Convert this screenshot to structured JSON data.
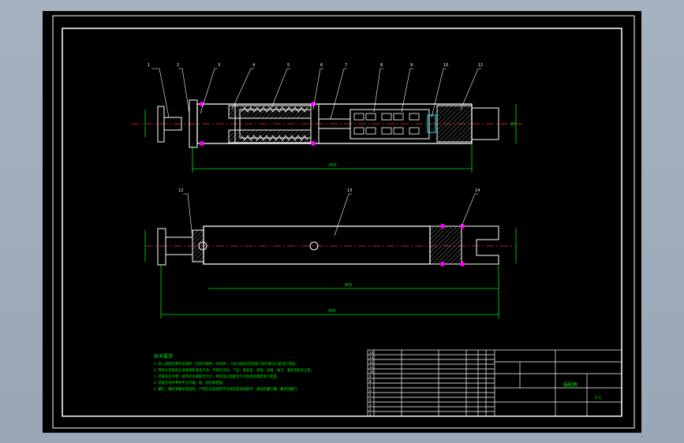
{
  "title_block": {
    "part_numbers": [
      "1",
      "2",
      "3",
      "4",
      "5",
      "6",
      "7",
      "8",
      "9",
      "10",
      "11",
      "12",
      "13",
      "14"
    ],
    "drawing_code": "装配图",
    "sheet": "1:1"
  },
  "callouts": {
    "top_view": [
      "1",
      "2",
      "3",
      "4",
      "5",
      "6",
      "7",
      "8",
      "9",
      "10",
      "11"
    ],
    "bottom_view": [
      "12",
      "13",
      "14"
    ]
  },
  "dimensions": {
    "top_overall": "650",
    "top_height": "80",
    "bottom_inner": "800",
    "bottom_overall": "950"
  },
  "tech_notes": {
    "heading": "技术要求",
    "lines": [
      "1. 进入装配的零件及部件（包括外购件、外协件），均必须具有检验部门的合格证方能进行装配。",
      "2. 零件在装配前必须清理和清洗干净，不得有毛刺、飞边、氧化皮、锈蚀、切屑、油污、着色剂和灰尘等。",
      "3. 装配前应对零、部件的主要配合尺寸，特别是过盈配合尺寸及相关精度进行复查。",
      "4. 装配过程中零件不允许磕、碰、划伤和锈蚀。",
      "5. 螺钉、螺栓和螺母紧固时，严禁打击或使用不合适的旋具和扳手。紧固后螺钉槽、螺母和螺钉。"
    ]
  },
  "colors": {
    "line": "#ffffff",
    "center": "#ff2a2a",
    "dim": "#00e600",
    "accent": "#ff00ff",
    "hatch": "#ffffff",
    "cyan": "#00ffff"
  }
}
